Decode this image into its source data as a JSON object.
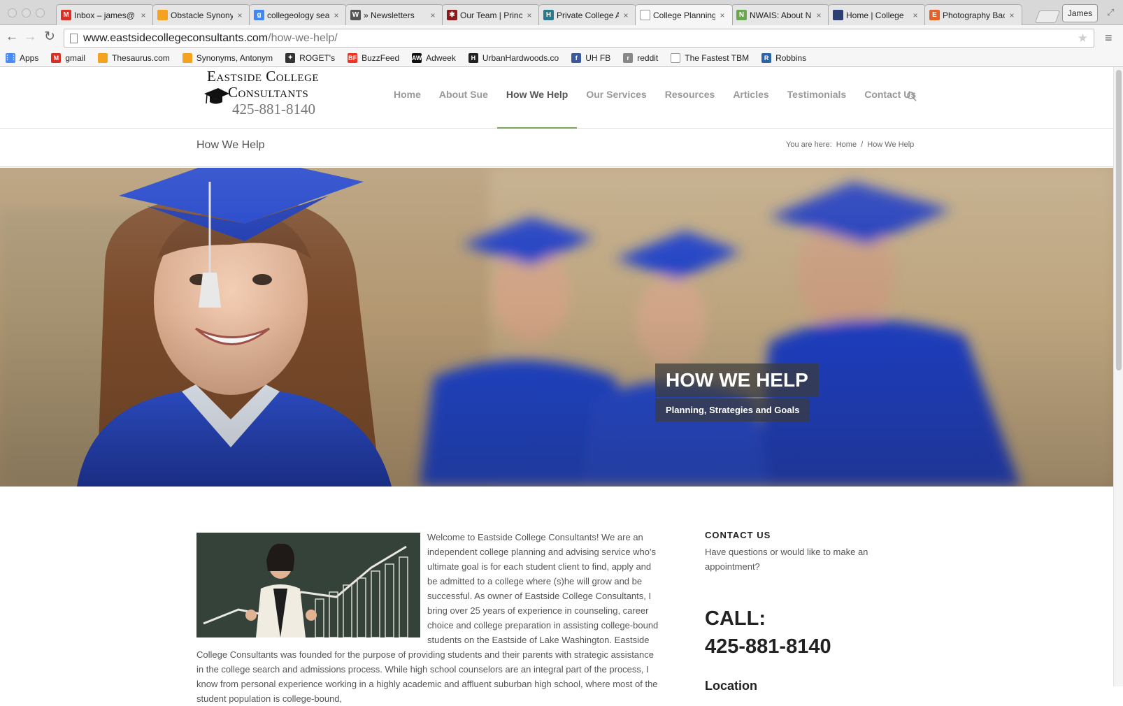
{
  "browser": {
    "tabs": [
      {
        "title": "Inbox – james@",
        "icon": "gmail-icon",
        "color": "#d93025",
        "glyph": "M"
      },
      {
        "title": "Obstacle Synony",
        "icon": "thesaurus-icon",
        "color": "#f4a21f",
        "glyph": ""
      },
      {
        "title": "collegeology sea",
        "icon": "google-icon",
        "color": "#4285f4",
        "glyph": "g"
      },
      {
        "title": "» Newsletters",
        "icon": "wordpress-icon",
        "color": "#555555",
        "glyph": "W"
      },
      {
        "title": "Our Team | Princ",
        "icon": "asterisk-icon",
        "color": "#8b1a1a",
        "glyph": "✱"
      },
      {
        "title": "Private College A",
        "icon": "h-icon",
        "color": "#2a7a8c",
        "glyph": "H"
      },
      {
        "title": "College Planning",
        "icon": "page-icon",
        "color": "#ffffff",
        "glyph": ""
      },
      {
        "title": "NWAIS: About N",
        "icon": "n-icon",
        "color": "#6aa84f",
        "glyph": "N"
      },
      {
        "title": "Home | College",
        "icon": "shield-icon",
        "color": "#2c3e73",
        "glyph": ""
      },
      {
        "title": "Photography Bac",
        "icon": "etsy-icon",
        "color": "#e5612a",
        "glyph": "E"
      }
    ],
    "active_tab": 6,
    "profile_name": "James",
    "url_host": "www.eastsidecollegeconsultants.com",
    "url_path": "/how-we-help/",
    "bookmarks": [
      {
        "label": "Apps",
        "icon": "apps-grid-icon",
        "color": "#4a8cf7",
        "glyph": "⋮⋮"
      },
      {
        "label": "gmail",
        "icon": "gmail-icon",
        "color": "#d93025",
        "glyph": "M"
      },
      {
        "label": "Thesaurus.com",
        "icon": "thesaurus-icon",
        "color": "#f4a21f",
        "glyph": ""
      },
      {
        "label": "Synonyms, Antonym",
        "icon": "thesaurus-icon",
        "color": "#f4a21f",
        "glyph": ""
      },
      {
        "label": "ROGET's",
        "icon": "roget-icon",
        "color": "#333333",
        "glyph": "✦"
      },
      {
        "label": "BuzzFeed",
        "icon": "buzzfeed-icon",
        "color": "#ee3322",
        "glyph": "BF"
      },
      {
        "label": "Adweek",
        "icon": "adweek-icon",
        "color": "#111111",
        "glyph": "AW"
      },
      {
        "label": "UrbanHardwoods.co",
        "icon": "uh-icon",
        "color": "#222222",
        "glyph": "H"
      },
      {
        "label": "UH FB",
        "icon": "facebook-icon",
        "color": "#3b5998",
        "glyph": "f"
      },
      {
        "label": "reddit",
        "icon": "reddit-icon",
        "color": "#888888",
        "glyph": "r"
      },
      {
        "label": "The Fastest TBM",
        "icon": "page-icon",
        "color": "#ffffff",
        "glyph": ""
      },
      {
        "label": "Robbins",
        "icon": "robbins-icon",
        "color": "#2c62a8",
        "glyph": "R"
      }
    ]
  },
  "site": {
    "logo_line1": "Eastside College",
    "logo_line2": "Consultants",
    "logo_phone": "425-881-8140",
    "nav": [
      "Home",
      "About Sue",
      "How We Help",
      "Our Services",
      "Resources",
      "Articles",
      "Testimonials",
      "Contact Us"
    ],
    "nav_current": 2,
    "accent_color": "#7ca35a",
    "page_title": "How We Help",
    "breadcrumb_prefix": "You are here:",
    "breadcrumb_home": "Home",
    "breadcrumb_sep": "/",
    "breadcrumb_current": "How We Help",
    "hero_heading": "HOW WE HELP",
    "hero_subheading": "Planning, Strategies and Goals",
    "intro_text": "Welcome to Eastside College Consultants!  We are an independent college planning and advising service who's ultimate goal is for each student client to find, apply and be admitted to a college where (s)he will grow and be successful.  As owner of Eastside College Consultants, I bring over 25 years of experience in counseling, career choice and college preparation in assisting college-bound students on the Eastside of Lake Washington.  Eastside College Consultants was founded for the purpose of providing students and their parents with strategic assistance in the college search and admissions process.  While high school counselors are an integral part of the process, I know from personal experience working in a highly academic and affluent suburban high school, where most of the student population is college-bound,",
    "sidebar_heading": "CONTACT US",
    "sidebar_text": "Have questions or would like to make an appointment?",
    "sidebar_call_label": "CALL:",
    "sidebar_call_number": "425-881-8140",
    "sidebar_location": "Location"
  }
}
